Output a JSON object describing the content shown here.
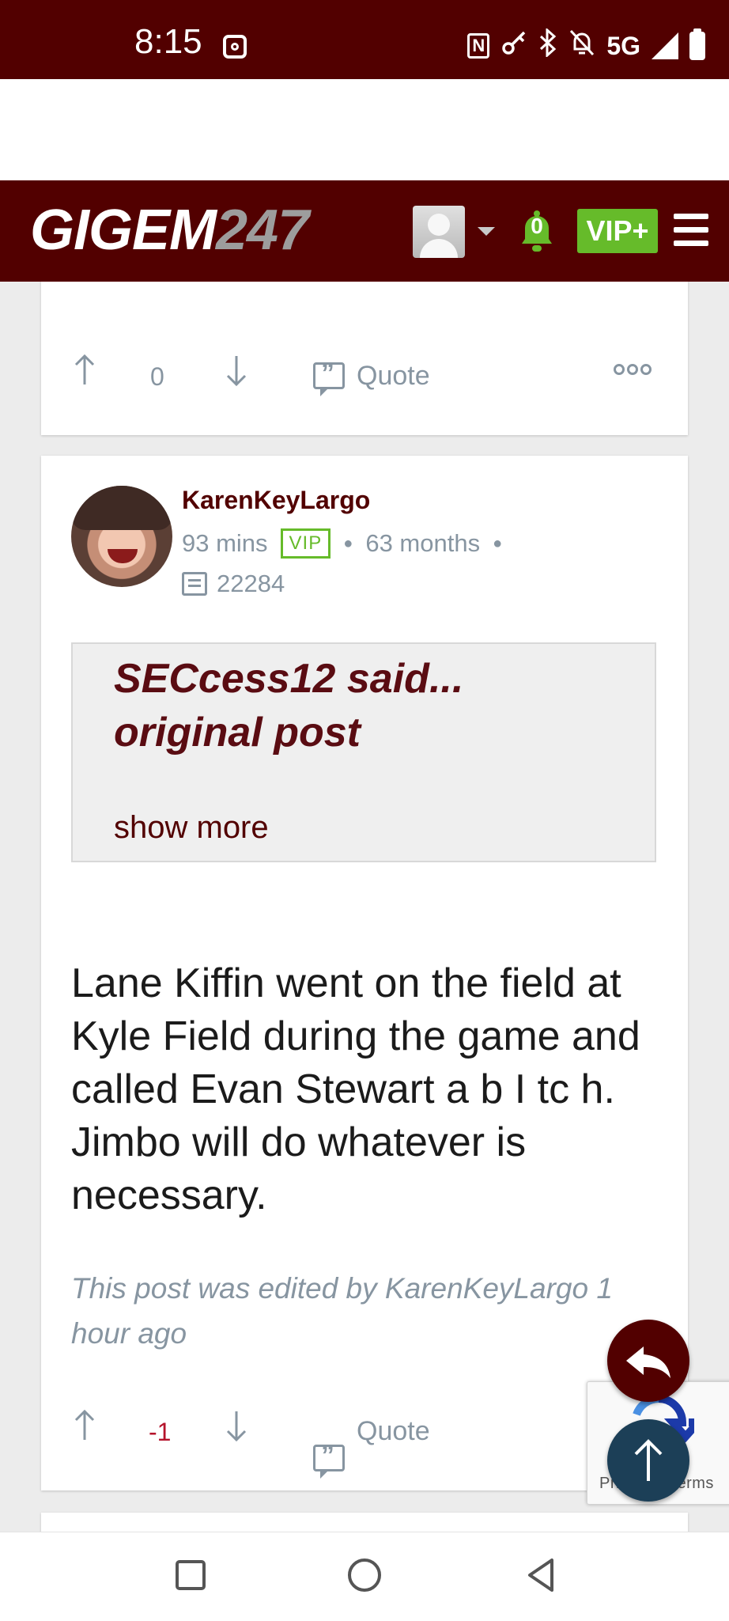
{
  "status_bar": {
    "time": "8:15",
    "network": "5G",
    "icons": [
      "screen-record-icon",
      "nfc-icon",
      "key-icon",
      "bluetooth-icon",
      "mute-bell-icon",
      "signal-icon",
      "battery-icon"
    ]
  },
  "header": {
    "logo_main": "GIGEM",
    "logo_suffix": "247",
    "notification_count": "0",
    "vip_label": "VIP+",
    "colors": {
      "bar": "#520000",
      "vip": "#66bb2a",
      "bell": "#66bb2a"
    }
  },
  "previous_post": {
    "vote_count": "0",
    "quote_label": "Quote"
  },
  "post": {
    "author": "KarenKeyLargo",
    "time_ago": "93 mins",
    "badge": "VIP",
    "membership": "63 months",
    "post_count": "22284",
    "quote": {
      "author": "SECcess12 said...",
      "title": "original post",
      "show_more": "show more"
    },
    "body": "Lane Kiffin went on the field at Kyle Field during the game and called Evan Stewart a b I tc h. Jimbo will do whatever is necessary.",
    "edited_note": "This post was edited by KarenKeyLargo 1 hour ago",
    "vote_count": "-1",
    "quote_label": "Quote"
  },
  "recaptcha": {
    "text": "Privacy - Terms"
  }
}
